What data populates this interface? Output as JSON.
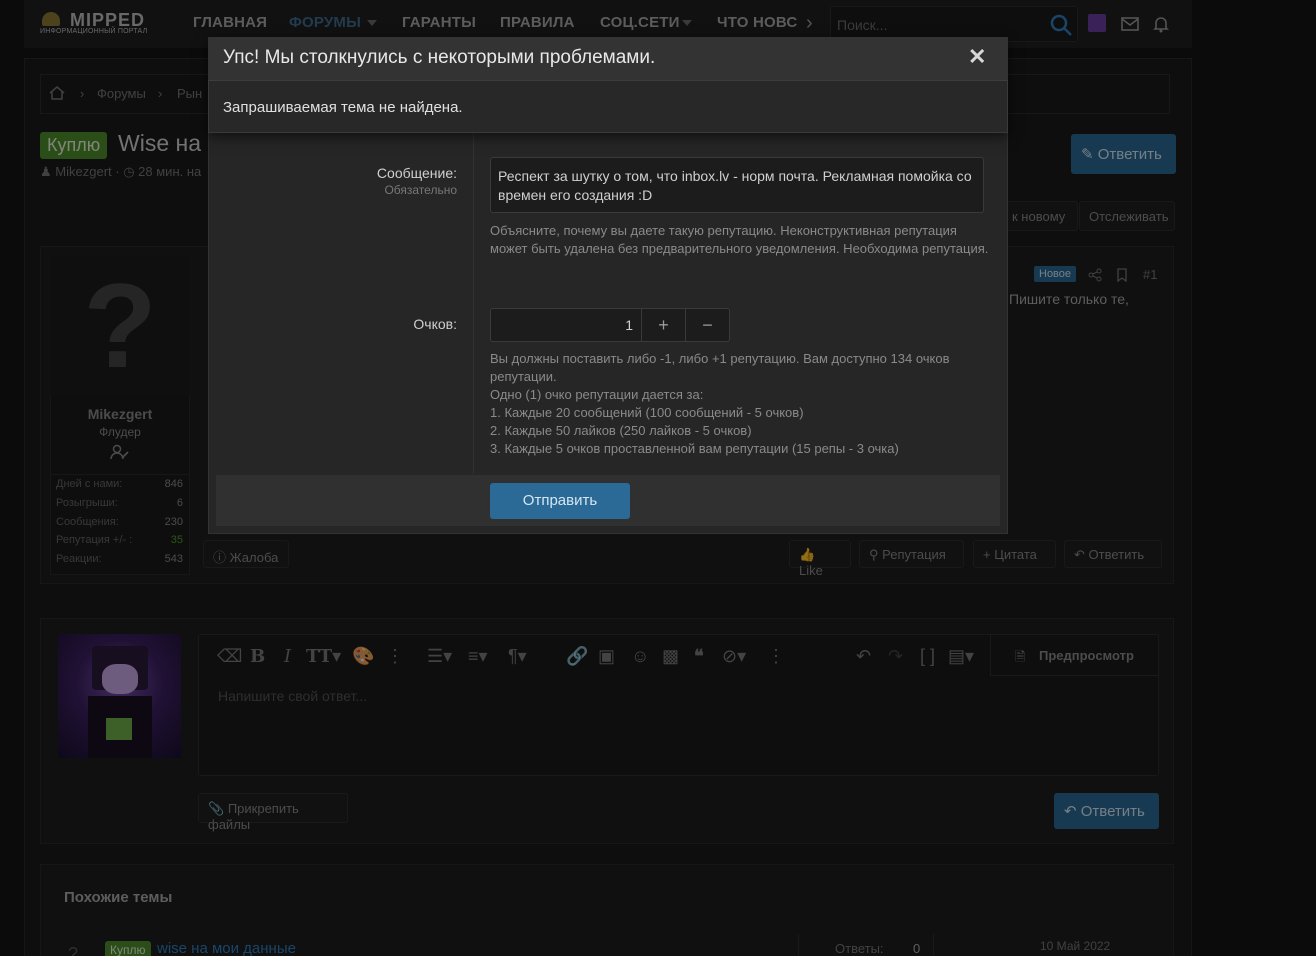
{
  "header": {
    "logo_main": "MIPPED",
    "logo_sub": "ИНФОРМАЦИОННЫЙ ПОРТАЛ",
    "nav": [
      "ГЛАВНАЯ",
      "ФОРУМЫ",
      "ГАРАНТЫ",
      "ПРАВИЛА",
      "СОЦ.СЕТИ",
      "ЧТО НОВС"
    ],
    "search_placeholder": "Поиск..."
  },
  "breadcrumb": {
    "forums": "Форумы",
    "market": "Рын"
  },
  "thread": {
    "tag": "Куплю",
    "title": "Wise на",
    "author": "Mikezgert",
    "time": "28 мин. на",
    "reply_button": "Ответить",
    "goto_new": "к новому",
    "watch": "Отслеживать"
  },
  "post": {
    "badge_new": "Новое",
    "number": "#1",
    "text_right": "Пишите только те,",
    "user": {
      "name": "Mikezgert",
      "title": "Флудер",
      "stats": [
        {
          "label": "Дней с нами:",
          "value": "846"
        },
        {
          "label": "Розыгрыши:",
          "value": "6"
        },
        {
          "label": "Сообщения:",
          "value": "230"
        },
        {
          "label": "Репутация +/- :",
          "value": "35"
        },
        {
          "label": "Реакции:",
          "value": "543"
        }
      ]
    },
    "actions": {
      "report": "Жалоба",
      "like": "Like",
      "reputation": "Репутация",
      "quote": "Цитата",
      "reply": "Ответить"
    }
  },
  "reply_form": {
    "placeholder": "Напишите свой ответ...",
    "preview": "Предпросмотр",
    "attach": "Прикрепить файлы",
    "submit": "Ответить"
  },
  "similar": {
    "heading": "Похожие темы",
    "item_tag": "Куплю",
    "item_title": "wise на мои данные",
    "replies_label": "Ответы:",
    "replies_value": "0",
    "date": "10 Май 2022"
  },
  "reputation_modal": {
    "message_label": "Сообщение:",
    "required": "Обязательно",
    "message_value": "Респект за шутку о том, что inbox.lv - норм почта. Рекламная помойка со времен его создания :D",
    "explain": "Объясните, почему вы даете такую репутацию. Неконструктивная репутация может быть удалена без предварительного уведомления. Необходима репутация.",
    "points_label": "Очков:",
    "points_value": "1",
    "rules": [
      "Вы должны поставить либо -1, либо +1 репутацию. Вам доступно 134 очков репутации.",
      "Одно (1) очко репутации дается за:",
      "1. Каждые 20 сообщений (100 сообщений - 5 очков)",
      "2. Каждые 50 лайков (250 лайков - 5 очков)",
      "3. Каждые 5 очков проставленной вам репутации (15 репы - 3 очка)"
    ],
    "submit": "Отправить"
  },
  "error_dialog": {
    "title": "Упс! Мы столкнулись с некоторыми проблемами.",
    "message": "Запрашиваемая тема не найдена."
  }
}
